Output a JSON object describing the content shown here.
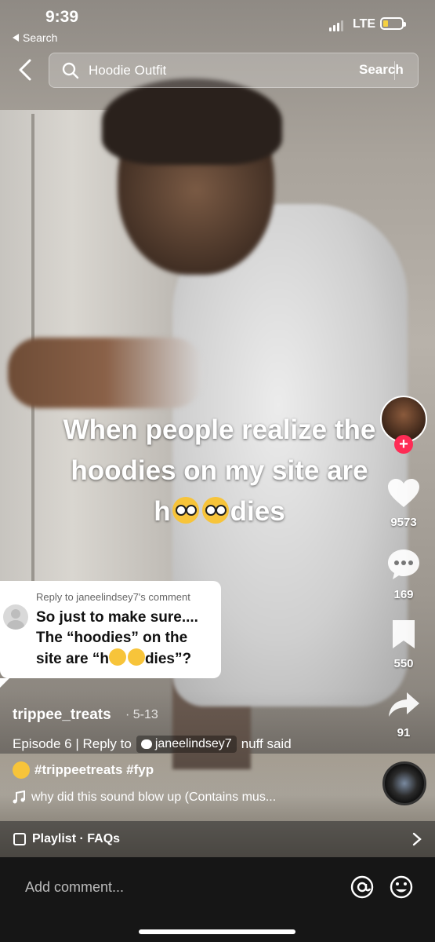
{
  "status_bar": {
    "time": "9:39",
    "back_app_label": "Search",
    "network": "LTE",
    "battery_color": "#f5d142"
  },
  "search": {
    "query": "Hoodie Outfit",
    "button_label": "Search",
    "icon": "search-icon"
  },
  "video": {
    "caption_line1": "When people realize the",
    "caption_line2": "hoodies on my site are",
    "caption_line3_start": "h",
    "caption_line3_end": "dies"
  },
  "reply_card": {
    "reply_to": "Reply to janeelindsey7's comment",
    "text_line1": "So just to make sure....",
    "text_line2": "The “hoodies” on the",
    "text_line3_start": "site are “h",
    "text_line3_end": "dies”?"
  },
  "actions": {
    "likes": "9573",
    "comments": "169",
    "saves": "550",
    "shares": "91",
    "follow_color": "#fe2c55"
  },
  "post": {
    "username": "trippee_treats",
    "date": "· 5-13",
    "description_prefix": "Episode 6 | Reply to",
    "mention": "janeelindsey7",
    "description_suffix": "nuff said",
    "hashtags": "#trippeetreats #fyp",
    "sound": "why did this sound blow up (Contains mus..."
  },
  "playlist": {
    "label": "Playlist · FAQs"
  },
  "comment_bar": {
    "placeholder": "Add comment..."
  }
}
